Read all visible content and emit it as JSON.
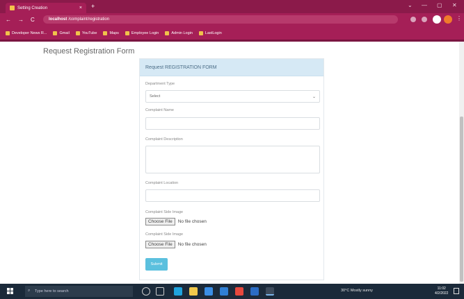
{
  "browser": {
    "tab_title": "Setting Creation",
    "tab_close": "×",
    "new_tab": "+",
    "window_controls": [
      "⌄",
      "—",
      "▢",
      "✕"
    ],
    "nav": {
      "back": "←",
      "forward": "→",
      "reload": "C"
    },
    "url": {
      "host": "localhost",
      "path": "/complaint/registration"
    },
    "bookmarks": [
      "Developer News R...",
      "Gmail",
      "YouTube",
      "Maps",
      "Employee Login",
      "Admin Login",
      "LastLogin"
    ]
  },
  "page": {
    "title": "Request Registration Form"
  },
  "form": {
    "header": "Request REGISTRATION FORM",
    "fields": {
      "department_type": {
        "label": "Department Type",
        "value": "Select"
      },
      "complaint_name": {
        "label": "Complaint Name",
        "value": ""
      },
      "complaint_description": {
        "label": "Complaint Description",
        "value": ""
      },
      "complaint_location": {
        "label": "Complaint Location",
        "value": ""
      },
      "image_1": {
        "label": "Complaint Side Image",
        "button": "Choose File",
        "status": "No file chosen"
      },
      "image_2": {
        "label": "Complaint Side Image",
        "button": "Choose File",
        "status": "No file chosen"
      }
    },
    "submit_label": "Submit"
  },
  "taskbar": {
    "search_placeholder": "Type here to search",
    "tray": "30°C Mostly sunny",
    "time": "11:02",
    "date": "4/2/2022"
  }
}
